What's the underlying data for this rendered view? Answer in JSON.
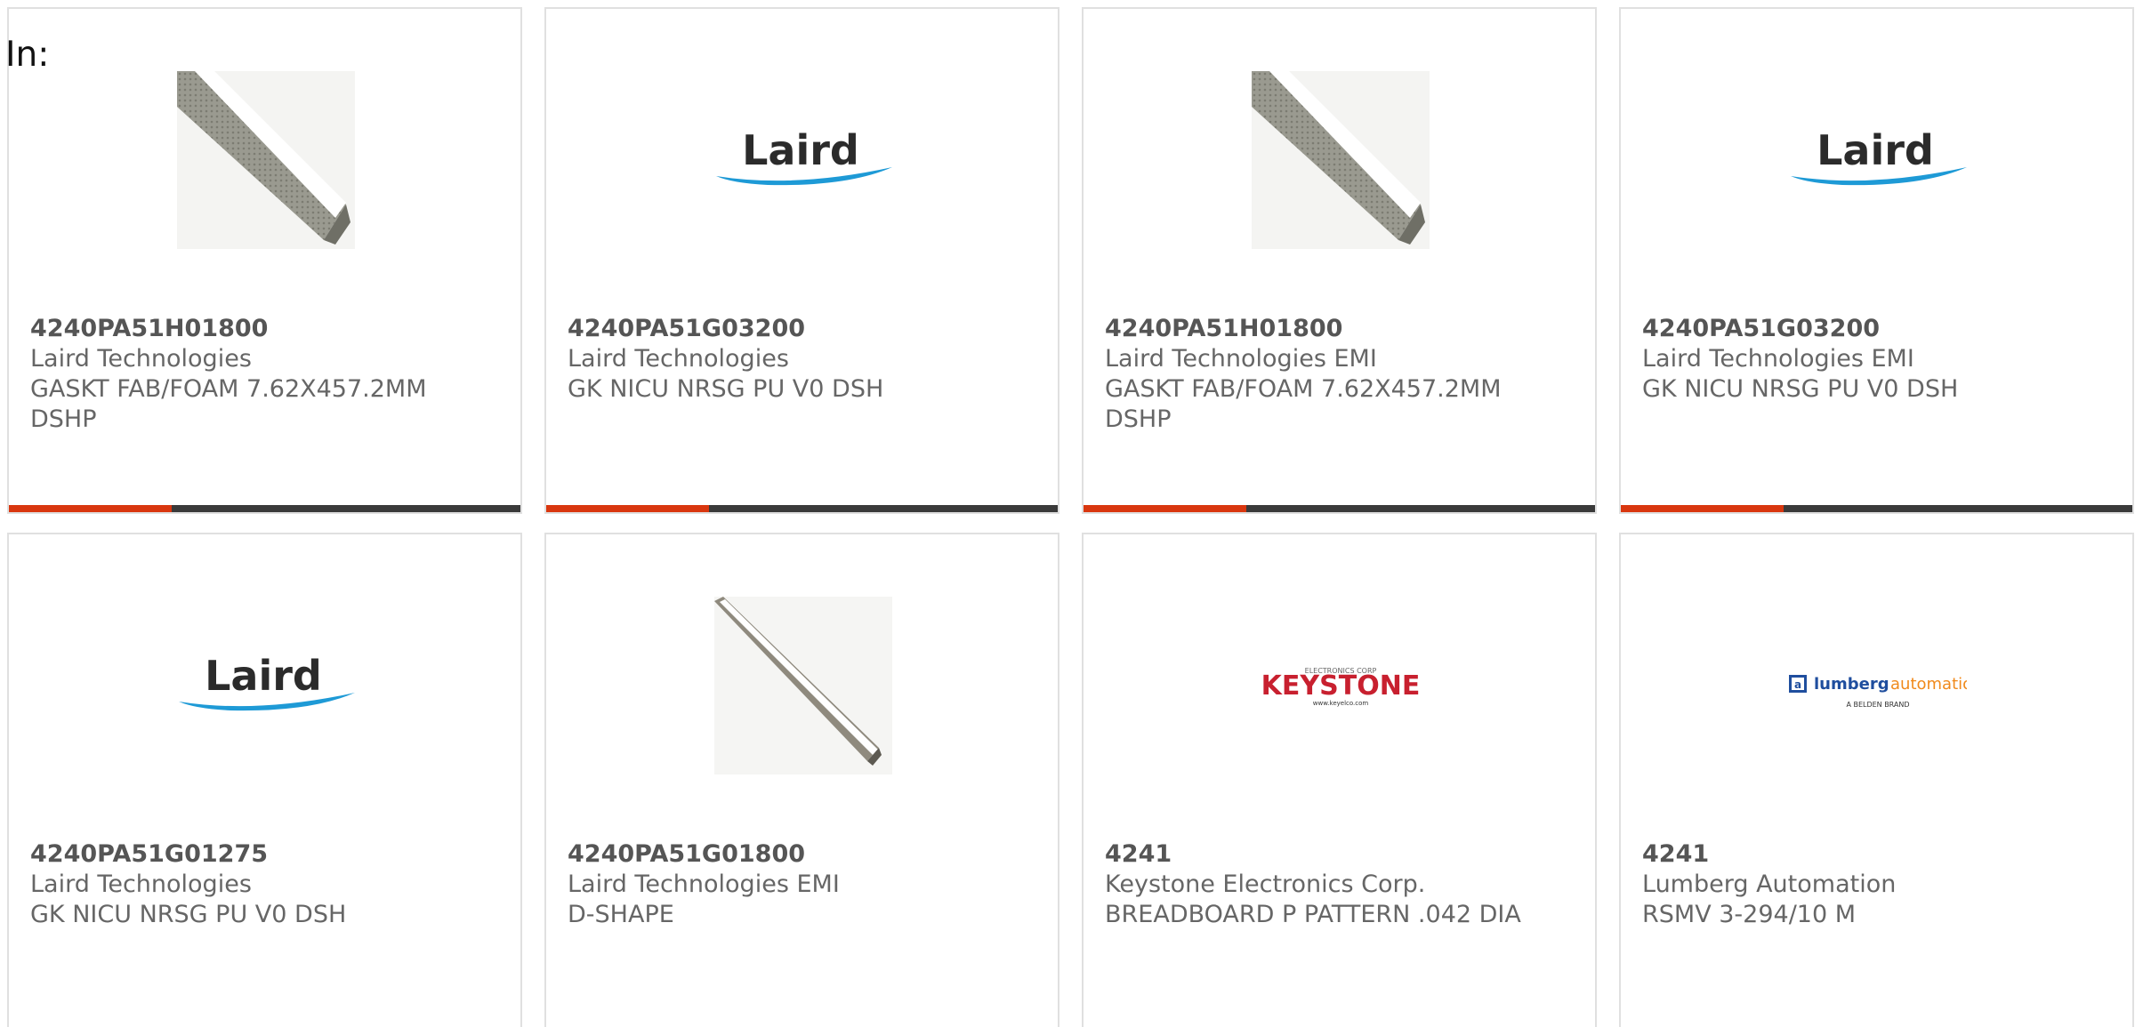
{
  "header": {
    "label": "In:"
  },
  "colors": {
    "accent": "#d9370f",
    "bar": "#3a3a3a",
    "border": "#e0e0e0",
    "text": "#666666"
  },
  "products": [
    {
      "part_number": "4240PA51H01800",
      "manufacturer": "Laird Technologies",
      "description": "GASKT FAB/FOAM 7.62X457.2MM DSHP",
      "image": "gasket-photo-icon"
    },
    {
      "part_number": "4240PA51G03200",
      "manufacturer": "Laird Technologies",
      "description": "GK NICU NRSG PU V0 DSH",
      "image": "laird-logo"
    },
    {
      "part_number": "4240PA51H01800",
      "manufacturer": "Laird Technologies EMI",
      "description": "GASKT FAB/FOAM 7.62X457.2MM DSHP",
      "image": "gasket-photo-icon"
    },
    {
      "part_number": "4240PA51G03200",
      "manufacturer": "Laird Technologies EMI",
      "description": "GK NICU NRSG PU V0 DSH",
      "image": "laird-logo"
    },
    {
      "part_number": "4240PA51G01275",
      "manufacturer": "Laird Technologies",
      "description": "GK NICU NRSG PU V0 DSH",
      "image": "laird-logo"
    },
    {
      "part_number": "4240PA51G01800",
      "manufacturer": "Laird Technologies EMI",
      "description": "D-SHAPE",
      "image": "dshape-gasket-photo-icon"
    },
    {
      "part_number": "4241",
      "manufacturer": "Keystone Electronics Corp.",
      "description": "BREADBOARD P PATTERN .042 DIA",
      "image": "keystone-logo"
    },
    {
      "part_number": "4241",
      "manufacturer": "Lumberg Automation",
      "description": "RSMV 3-294/10 M",
      "image": "lumberg-logo"
    }
  ],
  "logos": {
    "laird": "Laird",
    "keystone": "KEYSTONE",
    "keystone_top": "ELECTRONICS CORP",
    "keystone_bottom": "www.keyelco.com",
    "lumberg_a": "lumberg",
    "lumberg_b": "automation",
    "lumberg_sub": "A BELDEN BRAND"
  }
}
